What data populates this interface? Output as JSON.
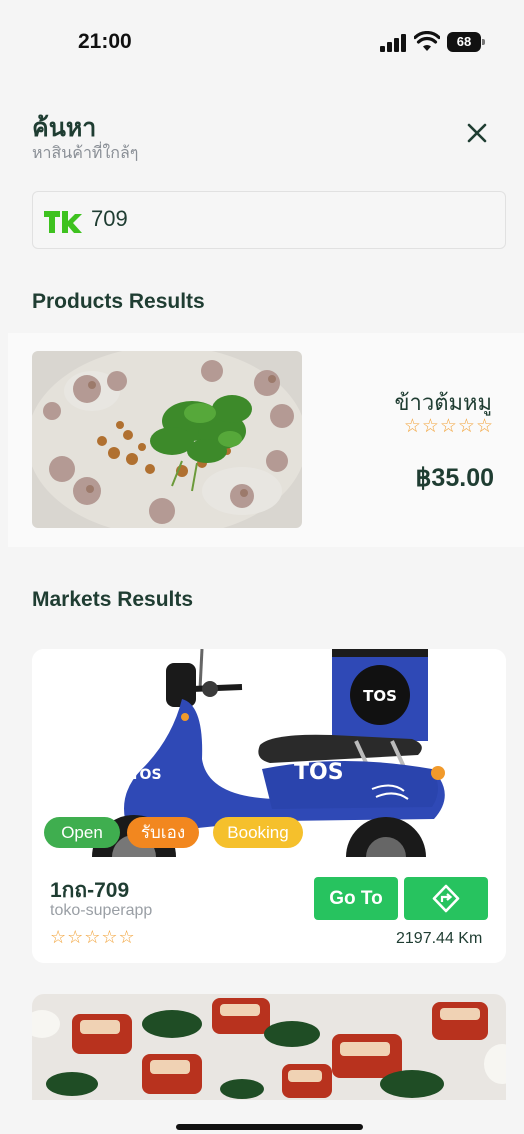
{
  "status_bar": {
    "time": "21:00",
    "battery": "68"
  },
  "header": {
    "title": "ค้นหา",
    "subtitle": "หาสินค้าที่ใกล้ๆ"
  },
  "search": {
    "value": "709"
  },
  "products": {
    "section_title": "Products Results",
    "items": [
      {
        "name": "ข้าวต้มหมู",
        "stars": "☆☆☆☆☆",
        "price": "฿35.00"
      }
    ]
  },
  "markets": {
    "section_title": "Markets Results",
    "items": [
      {
        "badges": [
          "Open",
          "รับเอง",
          "Booking"
        ],
        "name": "1กถ-709",
        "subtitle": "toko-superapp",
        "stars": "☆☆☆☆☆",
        "goto_label": "Go To",
        "distance": "2197.44 Km"
      }
    ]
  },
  "colors": {
    "primary": "#27c35f",
    "text": "#1f3d32",
    "star": "#f2a33a",
    "open": "#3fae4f",
    "pickup": "#f2871f",
    "booking": "#f5c02c"
  },
  "icons": {
    "close": "close-icon",
    "logo": "tk-logo-icon",
    "navigate": "direction-icon"
  }
}
